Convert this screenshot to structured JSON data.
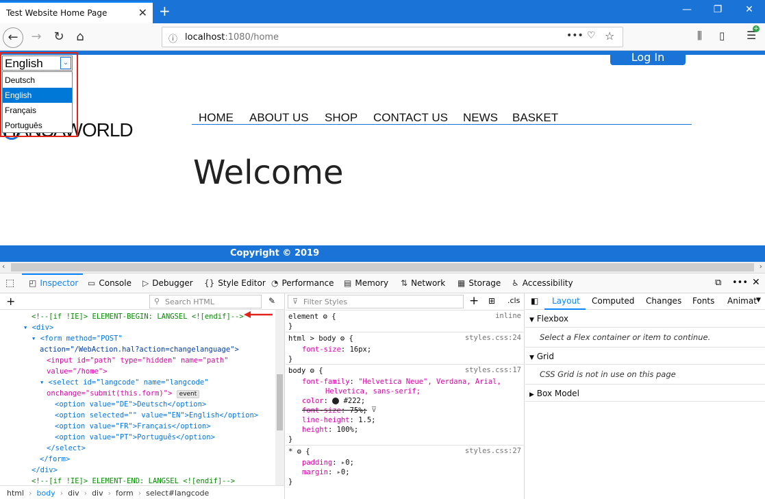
{
  "browser": {
    "tab_title": "Test Website Home Page",
    "url_host": "localhost",
    "url_rest": ":1080/home"
  },
  "page": {
    "login_label": "Log In",
    "logo_text": "HANSAWORLD",
    "menu": [
      "HOME",
      "ABOUT US",
      "SHOP",
      "CONTACT US",
      "NEWS",
      "BASKET"
    ],
    "welcome": "Welcome",
    "copyright": "Copyright © 2019",
    "language_select": {
      "current": "English",
      "options": [
        "Deutsch",
        "English",
        "Français",
        "Português"
      ],
      "selected_index": 1
    }
  },
  "devtools": {
    "tabs": [
      "Inspector",
      "Console",
      "Debugger",
      "Style Editor",
      "Performance",
      "Memory",
      "Network",
      "Storage",
      "Accessibility"
    ],
    "search_html_placeholder": "Search HTML",
    "filter_styles_placeholder": "Filter Styles",
    "cls_label": ".cls",
    "markup_lines": [
      "<!--[if !IE]> ELEMENT-BEGIN: LANGSEL <![endif]-->",
      "<div>",
      "<form method=\"POST\"",
      "action=\"/WebAction.hal?action=changelanguage\">",
      "<input id=\"path\" type=\"hidden\" name=\"path\"",
      "value=\"/home\">",
      "<select id=\"langcode\" name=\"langcode\"",
      "onchange=\"submit(this.form)\">",
      "event",
      "<option value=\"DE\">Deutsch</option>",
      "<option selected=\"\" value=\"EN\">English</option>",
      "<option value=\"FR\">Français</option>",
      "<option value=\"PT\">Português</option>",
      "</select>",
      "</form>",
      "</div>",
      "<!--[if !IE]> ELEMENT-END: LANGSEL <![endif]-->"
    ],
    "breadcrumb": [
      "html",
      "body",
      "div",
      "div",
      "form",
      "select#langcode"
    ],
    "rules": [
      {
        "selector": "element",
        "source": "inline",
        "props": []
      },
      {
        "selector": "html > body",
        "source": "styles.css:24",
        "props": [
          {
            "name": "font-size",
            "value": "16px"
          }
        ]
      },
      {
        "selector": "body",
        "source": "styles.css:17",
        "props": [
          {
            "name": "font-family",
            "value": "\"Helvetica Neue\", Verdana, Arial,"
          },
          {
            "name": "",
            "value": "Helvetica, sans-serif;"
          },
          {
            "name": "color",
            "value": "#222"
          },
          {
            "name": "font-size",
            "value": "75%"
          },
          {
            "name": "line-height",
            "value": "1.5"
          },
          {
            "name": "height",
            "value": "100%"
          }
        ]
      },
      {
        "selector": "*",
        "source": "styles.css:27",
        "props": [
          {
            "name": "padding",
            "value": "0"
          },
          {
            "name": "margin",
            "value": "0"
          }
        ]
      }
    ],
    "layout_tabs": [
      "Layout",
      "Computed",
      "Changes",
      "Fonts",
      "Animat"
    ],
    "layout_sections": [
      {
        "title": "Flexbox",
        "note": "Select a Flex container or item to continue."
      },
      {
        "title": "Grid",
        "note": "CSS Grid is not in use on this page"
      },
      {
        "title": "Box Model",
        "note": ""
      }
    ]
  }
}
